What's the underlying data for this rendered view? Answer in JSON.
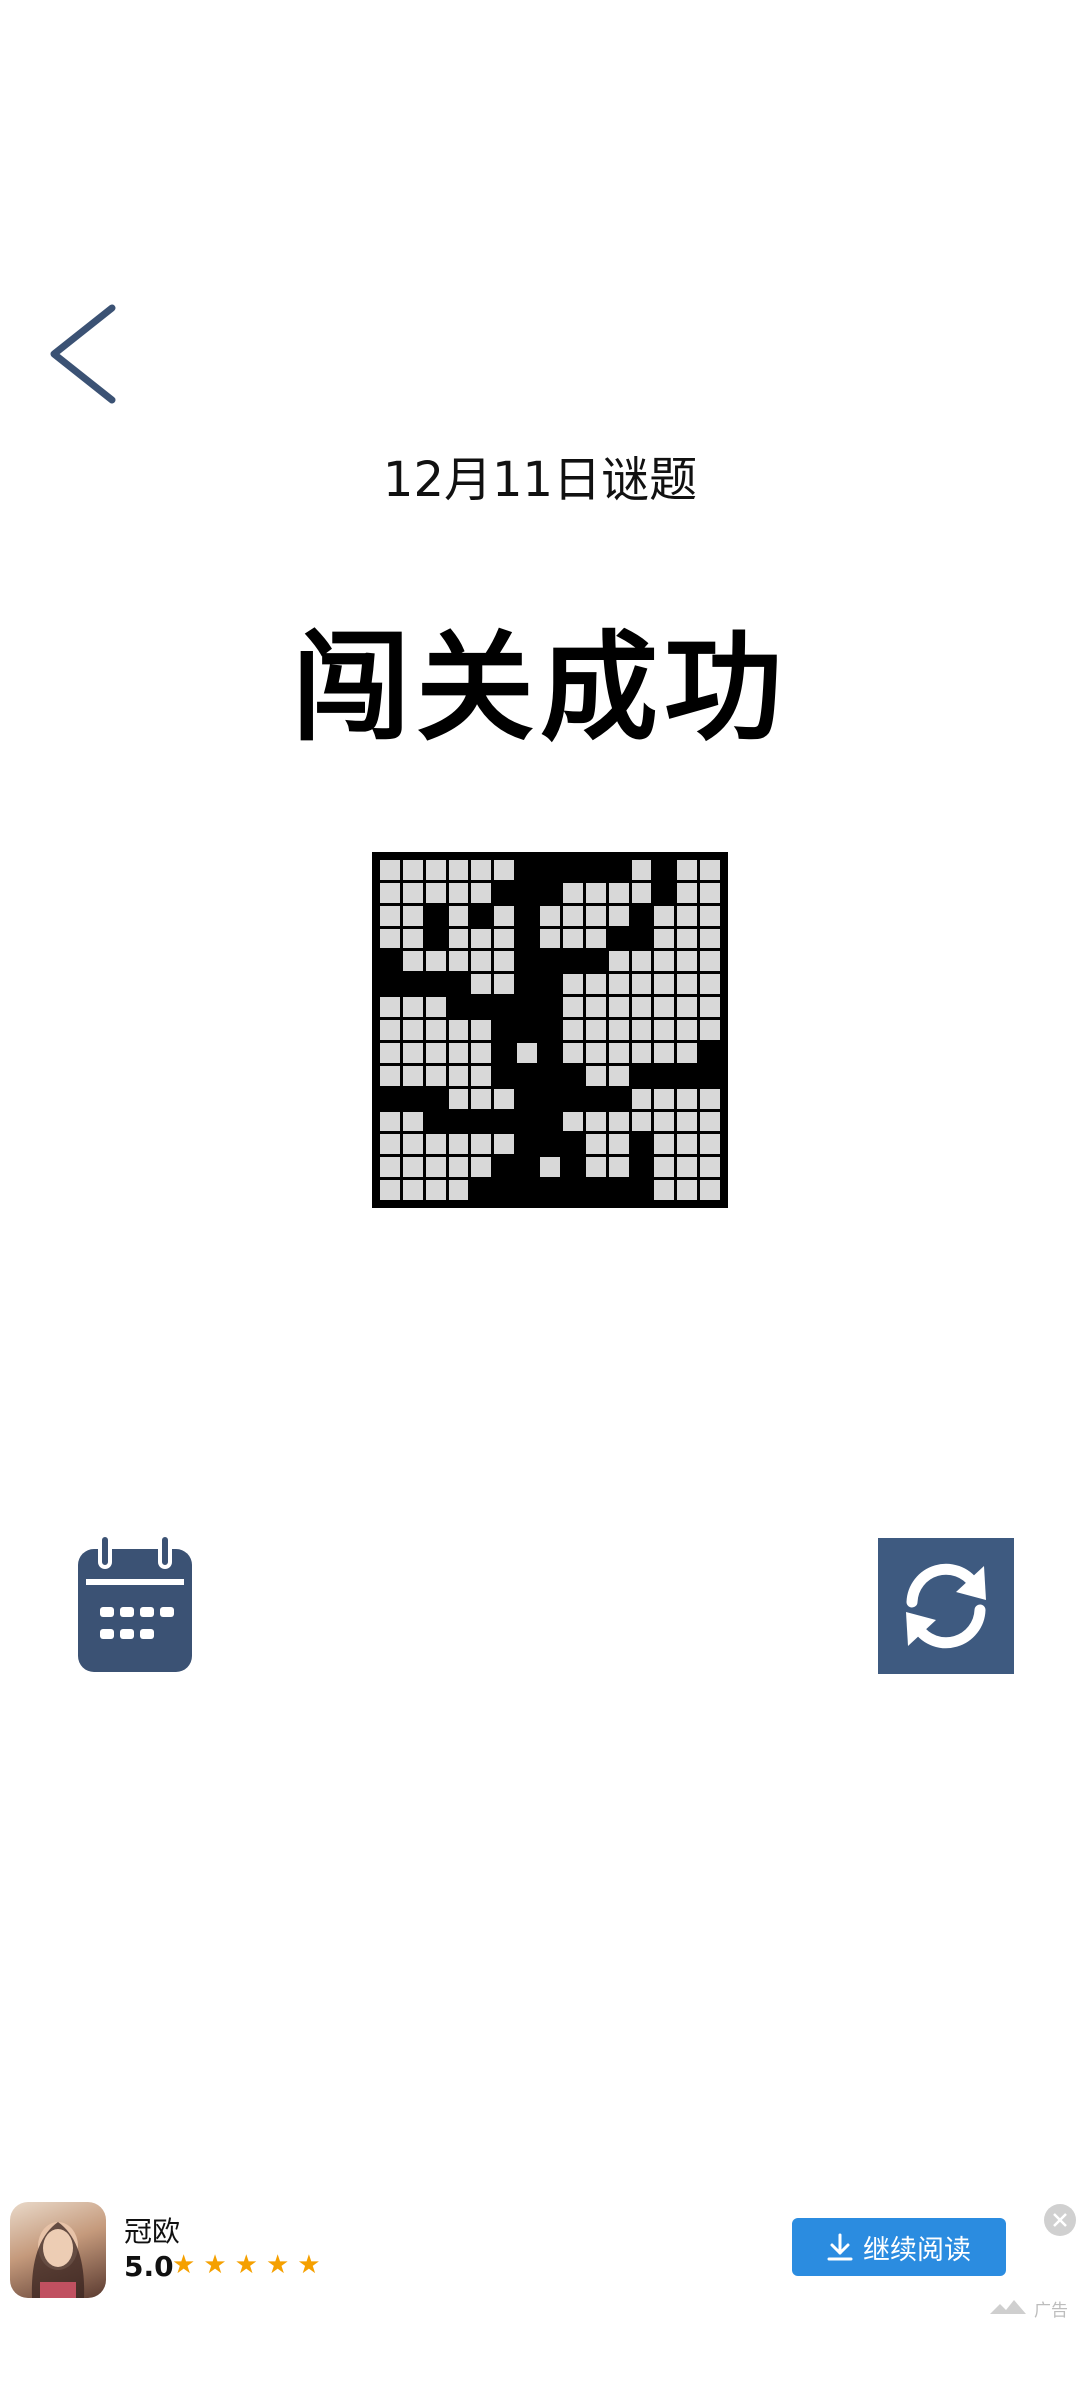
{
  "header": {
    "back_icon": "chevron-left-icon"
  },
  "puzzle": {
    "date_title": "12月11日谜题",
    "status": "闯关成功",
    "grid_size": 15,
    "rows": [
      "000000111110100",
      "000001110000100",
      "001010100001000",
      "001000100011000",
      "100000111100000",
      "111100110000000",
      "000111110000000",
      "000001110000000",
      "000001010000001",
      "000001111001111",
      "111000111110000",
      "001111110000000",
      "000000111001000",
      "000001101001000",
      "000011111111000"
    ],
    "on_color": "#000000",
    "off_color": "#d8d8d8"
  },
  "actions": {
    "calendar_icon": "calendar-icon",
    "refresh_icon": "refresh-icon",
    "accent_color": "#3e5a80"
  },
  "ad": {
    "app_name": "冠欧",
    "rating": "5.0",
    "stars": 5,
    "cta_label": "继续阅读",
    "ad_label": "广告",
    "cta_color": "#2b8ce0"
  }
}
